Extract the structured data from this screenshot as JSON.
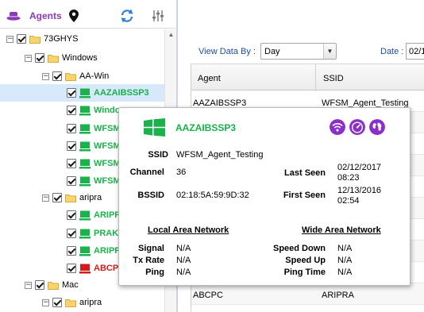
{
  "header": {
    "title": "Agents",
    "colors": {
      "agents_purple": "#8a3ab9",
      "link_blue": "#1d4e9b",
      "online_green": "#19b24b",
      "offline_red": "#d11a1a"
    },
    "icons": [
      "agent-hat-icon",
      "location-pin-icon",
      "refresh-icon",
      "column-settings-icon"
    ]
  },
  "tree": {
    "nodes": [
      {
        "label": "73GHYS",
        "type": "folder",
        "expander": "−"
      },
      {
        "label": "Windows",
        "type": "folder",
        "expander": "−"
      },
      {
        "label": "AA-Win",
        "type": "folder",
        "expander": "−"
      },
      {
        "label": "AAZAIBSSP3",
        "type": "agent",
        "status": "online",
        "selected": true
      },
      {
        "label": "Windo",
        "type": "agent",
        "status": "online"
      },
      {
        "label": "WFSM",
        "type": "agent",
        "status": "online"
      },
      {
        "label": "WFSM",
        "type": "agent",
        "status": "online"
      },
      {
        "label": "WFSM",
        "type": "agent",
        "status": "online"
      },
      {
        "label": "aripra",
        "type": "folder",
        "expander": "−"
      },
      {
        "label": "ARIPR",
        "type": "agent",
        "status": "online"
      },
      {
        "label": "PRAKA",
        "type": "agent",
        "status": "online"
      },
      {
        "label": "ARIPR",
        "type": "agent",
        "status": "online"
      },
      {
        "label": "ABCPC",
        "type": "agent",
        "status": "offline"
      },
      {
        "label": "Mac",
        "type": "folder",
        "expander": "−"
      },
      {
        "label": "aripra",
        "type": "folder",
        "expander": "−"
      }
    ]
  },
  "controls": {
    "view_by_label": "View Data By :",
    "view_by_value": "Day",
    "date_label": "Date :",
    "date_value": "02/1"
  },
  "table": {
    "columns": [
      "Agent",
      "SSID"
    ],
    "rows": [
      {
        "agent": "AAZAIBSSP3",
        "ssid": "WFSM_Agent_Testing"
      },
      {
        "agent": "",
        "ssid": ""
      },
      {
        "agent": "",
        "ssid": ""
      },
      {
        "agent": "",
        "ssid": ""
      },
      {
        "agent": "",
        "ssid": ""
      },
      {
        "agent": "",
        "ssid": ""
      },
      {
        "agent": "",
        "ssid": ""
      },
      {
        "agent": "",
        "ssid": ""
      },
      {
        "agent": "",
        "ssid": ""
      },
      {
        "agent": "ABCPC",
        "ssid": "ARIPRA"
      },
      {
        "agent": "",
        "ssid": ""
      }
    ]
  },
  "popup": {
    "agent_name": "AAZAIBSSP3",
    "icons": [
      "windows-logo-icon",
      "wifi-icon",
      "speedometer-icon",
      "globe-icon"
    ],
    "ssid_label": "SSID",
    "ssid_value": "WFSM_Agent_Testing",
    "channel_label": "Channel",
    "channel_value": "36",
    "bssid_label": "BSSID",
    "bssid_value": "02:18:5A:59:9D:32",
    "last_seen_label": "Last Seen",
    "last_seen_date": "02/12/2017",
    "last_seen_time": "08:23",
    "first_seen_label": "First Seen",
    "first_seen_date": "12/13/2016",
    "first_seen_time": "02:54",
    "lan_heading": "Local Area Network",
    "wan_heading": "Wide Area Network",
    "signal_label": "Signal",
    "signal_value": "N/A",
    "tx_rate_label": "Tx Rate",
    "tx_rate_value": "N/A",
    "ping_label": "Ping",
    "ping_value": "N/A",
    "speed_down_label": "Speed Down",
    "speed_down_value": "N/A",
    "speed_up_label": "Speed Up",
    "speed_up_value": "N/A",
    "ping_time_label": "Ping Time",
    "ping_time_value": "N/A"
  }
}
